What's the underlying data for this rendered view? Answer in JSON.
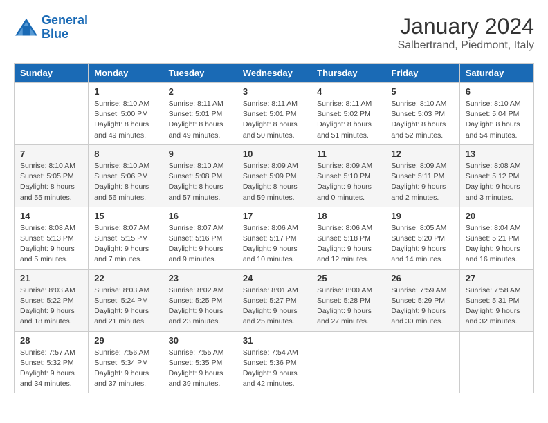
{
  "logo": {
    "name_part1": "General",
    "name_part2": "Blue"
  },
  "title": "January 2024",
  "subtitle": "Salbertrand, Piedmont, Italy",
  "headers": [
    "Sunday",
    "Monday",
    "Tuesday",
    "Wednesday",
    "Thursday",
    "Friday",
    "Saturday"
  ],
  "weeks": [
    [
      {
        "day": "",
        "sunrise": "",
        "sunset": "",
        "daylight": ""
      },
      {
        "day": "1",
        "sunrise": "Sunrise: 8:10 AM",
        "sunset": "Sunset: 5:00 PM",
        "daylight": "Daylight: 8 hours and 49 minutes."
      },
      {
        "day": "2",
        "sunrise": "Sunrise: 8:11 AM",
        "sunset": "Sunset: 5:01 PM",
        "daylight": "Daylight: 8 hours and 49 minutes."
      },
      {
        "day": "3",
        "sunrise": "Sunrise: 8:11 AM",
        "sunset": "Sunset: 5:01 PM",
        "daylight": "Daylight: 8 hours and 50 minutes."
      },
      {
        "day": "4",
        "sunrise": "Sunrise: 8:11 AM",
        "sunset": "Sunset: 5:02 PM",
        "daylight": "Daylight: 8 hours and 51 minutes."
      },
      {
        "day": "5",
        "sunrise": "Sunrise: 8:10 AM",
        "sunset": "Sunset: 5:03 PM",
        "daylight": "Daylight: 8 hours and 52 minutes."
      },
      {
        "day": "6",
        "sunrise": "Sunrise: 8:10 AM",
        "sunset": "Sunset: 5:04 PM",
        "daylight": "Daylight: 8 hours and 54 minutes."
      }
    ],
    [
      {
        "day": "7",
        "sunrise": "Sunrise: 8:10 AM",
        "sunset": "Sunset: 5:05 PM",
        "daylight": "Daylight: 8 hours and 55 minutes."
      },
      {
        "day": "8",
        "sunrise": "Sunrise: 8:10 AM",
        "sunset": "Sunset: 5:06 PM",
        "daylight": "Daylight: 8 hours and 56 minutes."
      },
      {
        "day": "9",
        "sunrise": "Sunrise: 8:10 AM",
        "sunset": "Sunset: 5:08 PM",
        "daylight": "Daylight: 8 hours and 57 minutes."
      },
      {
        "day": "10",
        "sunrise": "Sunrise: 8:09 AM",
        "sunset": "Sunset: 5:09 PM",
        "daylight": "Daylight: 8 hours and 59 minutes."
      },
      {
        "day": "11",
        "sunrise": "Sunrise: 8:09 AM",
        "sunset": "Sunset: 5:10 PM",
        "daylight": "Daylight: 9 hours and 0 minutes."
      },
      {
        "day": "12",
        "sunrise": "Sunrise: 8:09 AM",
        "sunset": "Sunset: 5:11 PM",
        "daylight": "Daylight: 9 hours and 2 minutes."
      },
      {
        "day": "13",
        "sunrise": "Sunrise: 8:08 AM",
        "sunset": "Sunset: 5:12 PM",
        "daylight": "Daylight: 9 hours and 3 minutes."
      }
    ],
    [
      {
        "day": "14",
        "sunrise": "Sunrise: 8:08 AM",
        "sunset": "Sunset: 5:13 PM",
        "daylight": "Daylight: 9 hours and 5 minutes."
      },
      {
        "day": "15",
        "sunrise": "Sunrise: 8:07 AM",
        "sunset": "Sunset: 5:15 PM",
        "daylight": "Daylight: 9 hours and 7 minutes."
      },
      {
        "day": "16",
        "sunrise": "Sunrise: 8:07 AM",
        "sunset": "Sunset: 5:16 PM",
        "daylight": "Daylight: 9 hours and 9 minutes."
      },
      {
        "day": "17",
        "sunrise": "Sunrise: 8:06 AM",
        "sunset": "Sunset: 5:17 PM",
        "daylight": "Daylight: 9 hours and 10 minutes."
      },
      {
        "day": "18",
        "sunrise": "Sunrise: 8:06 AM",
        "sunset": "Sunset: 5:18 PM",
        "daylight": "Daylight: 9 hours and 12 minutes."
      },
      {
        "day": "19",
        "sunrise": "Sunrise: 8:05 AM",
        "sunset": "Sunset: 5:20 PM",
        "daylight": "Daylight: 9 hours and 14 minutes."
      },
      {
        "day": "20",
        "sunrise": "Sunrise: 8:04 AM",
        "sunset": "Sunset: 5:21 PM",
        "daylight": "Daylight: 9 hours and 16 minutes."
      }
    ],
    [
      {
        "day": "21",
        "sunrise": "Sunrise: 8:03 AM",
        "sunset": "Sunset: 5:22 PM",
        "daylight": "Daylight: 9 hours and 18 minutes."
      },
      {
        "day": "22",
        "sunrise": "Sunrise: 8:03 AM",
        "sunset": "Sunset: 5:24 PM",
        "daylight": "Daylight: 9 hours and 21 minutes."
      },
      {
        "day": "23",
        "sunrise": "Sunrise: 8:02 AM",
        "sunset": "Sunset: 5:25 PM",
        "daylight": "Daylight: 9 hours and 23 minutes."
      },
      {
        "day": "24",
        "sunrise": "Sunrise: 8:01 AM",
        "sunset": "Sunset: 5:27 PM",
        "daylight": "Daylight: 9 hours and 25 minutes."
      },
      {
        "day": "25",
        "sunrise": "Sunrise: 8:00 AM",
        "sunset": "Sunset: 5:28 PM",
        "daylight": "Daylight: 9 hours and 27 minutes."
      },
      {
        "day": "26",
        "sunrise": "Sunrise: 7:59 AM",
        "sunset": "Sunset: 5:29 PM",
        "daylight": "Daylight: 9 hours and 30 minutes."
      },
      {
        "day": "27",
        "sunrise": "Sunrise: 7:58 AM",
        "sunset": "Sunset: 5:31 PM",
        "daylight": "Daylight: 9 hours and 32 minutes."
      }
    ],
    [
      {
        "day": "28",
        "sunrise": "Sunrise: 7:57 AM",
        "sunset": "Sunset: 5:32 PM",
        "daylight": "Daylight: 9 hours and 34 minutes."
      },
      {
        "day": "29",
        "sunrise": "Sunrise: 7:56 AM",
        "sunset": "Sunset: 5:34 PM",
        "daylight": "Daylight: 9 hours and 37 minutes."
      },
      {
        "day": "30",
        "sunrise": "Sunrise: 7:55 AM",
        "sunset": "Sunset: 5:35 PM",
        "daylight": "Daylight: 9 hours and 39 minutes."
      },
      {
        "day": "31",
        "sunrise": "Sunrise: 7:54 AM",
        "sunset": "Sunset: 5:36 PM",
        "daylight": "Daylight: 9 hours and 42 minutes."
      },
      {
        "day": "",
        "sunrise": "",
        "sunset": "",
        "daylight": ""
      },
      {
        "day": "",
        "sunrise": "",
        "sunset": "",
        "daylight": ""
      },
      {
        "day": "",
        "sunrise": "",
        "sunset": "",
        "daylight": ""
      }
    ]
  ]
}
